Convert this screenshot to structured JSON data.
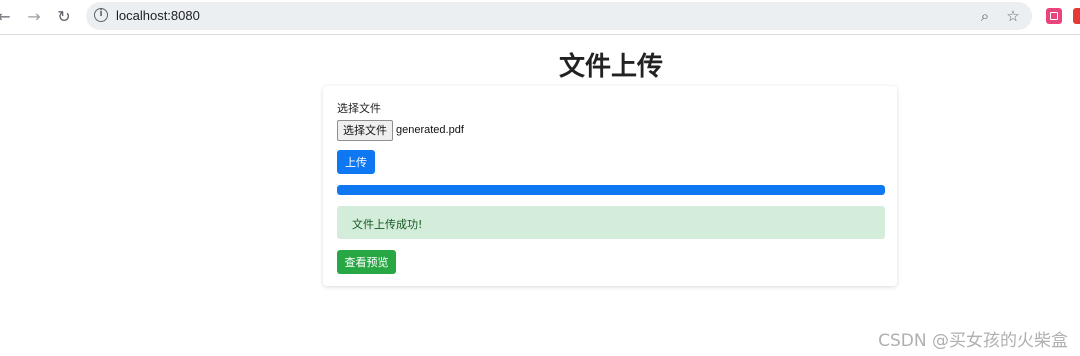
{
  "browser": {
    "url": "localhost:8080",
    "icons": [
      "back-icon",
      "forward-icon",
      "reload-icon",
      "info-icon",
      "zoom-icon",
      "star-icon",
      "extension-icon"
    ]
  },
  "page": {
    "title": "文件上传",
    "form": {
      "file_label": "选择文件",
      "choose_button": "选择文件",
      "file_name": "generated.pdf",
      "upload_button": "上传",
      "progress_percent": 100,
      "success_message": "文件上传成功!",
      "preview_button": "查看预览"
    }
  },
  "colors": {
    "primary": "#0d78f2",
    "success_bg": "#d4edda",
    "success_text": "#155724",
    "preview_button": "#28a745"
  },
  "watermark": "CSDN @买女孩的火柴盒"
}
